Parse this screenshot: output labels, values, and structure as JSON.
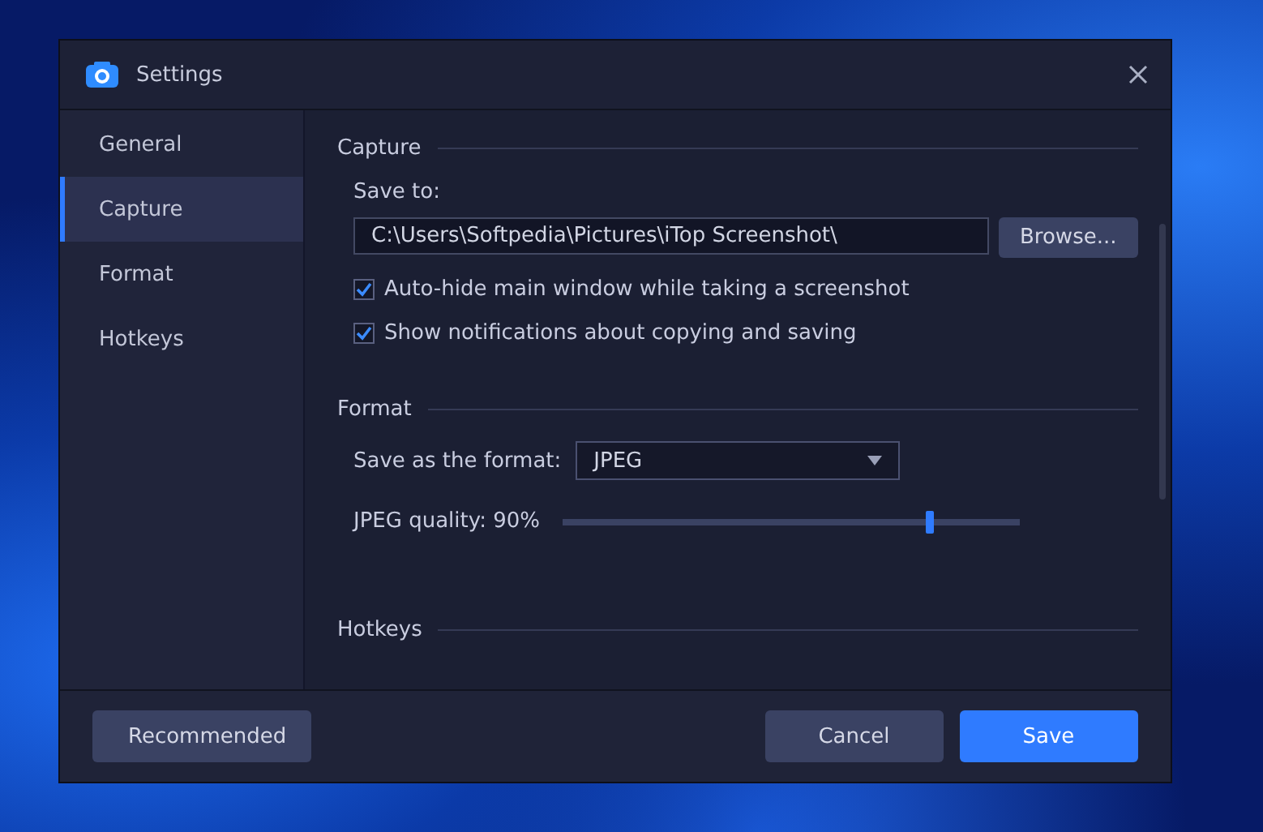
{
  "window": {
    "title": "Settings"
  },
  "sidebar": {
    "items": [
      {
        "label": "General",
        "selected": false
      },
      {
        "label": "Capture",
        "selected": true
      },
      {
        "label": "Format",
        "selected": false
      },
      {
        "label": "Hotkeys",
        "selected": false
      }
    ]
  },
  "capture": {
    "heading": "Capture",
    "save_to_label": "Save to:",
    "path": "C:\\Users\\Softpedia\\Pictures\\iTop Screenshot\\",
    "browse": "Browse...",
    "options": [
      {
        "label": "Auto-hide main window while taking a screenshot",
        "checked": true
      },
      {
        "label": "Show notifications about copying and saving",
        "checked": true
      }
    ]
  },
  "format": {
    "heading": "Format",
    "format_label": "Save as the format:",
    "format_value": "JPEG",
    "quality_label": "JPEG quality: 90%",
    "quality": {
      "level": 0.8
    }
  },
  "hotkeys": {
    "heading": "Hotkeys"
  },
  "footer": {
    "recommended": "Recommended",
    "cancel": "Cancel",
    "save": "Save"
  }
}
